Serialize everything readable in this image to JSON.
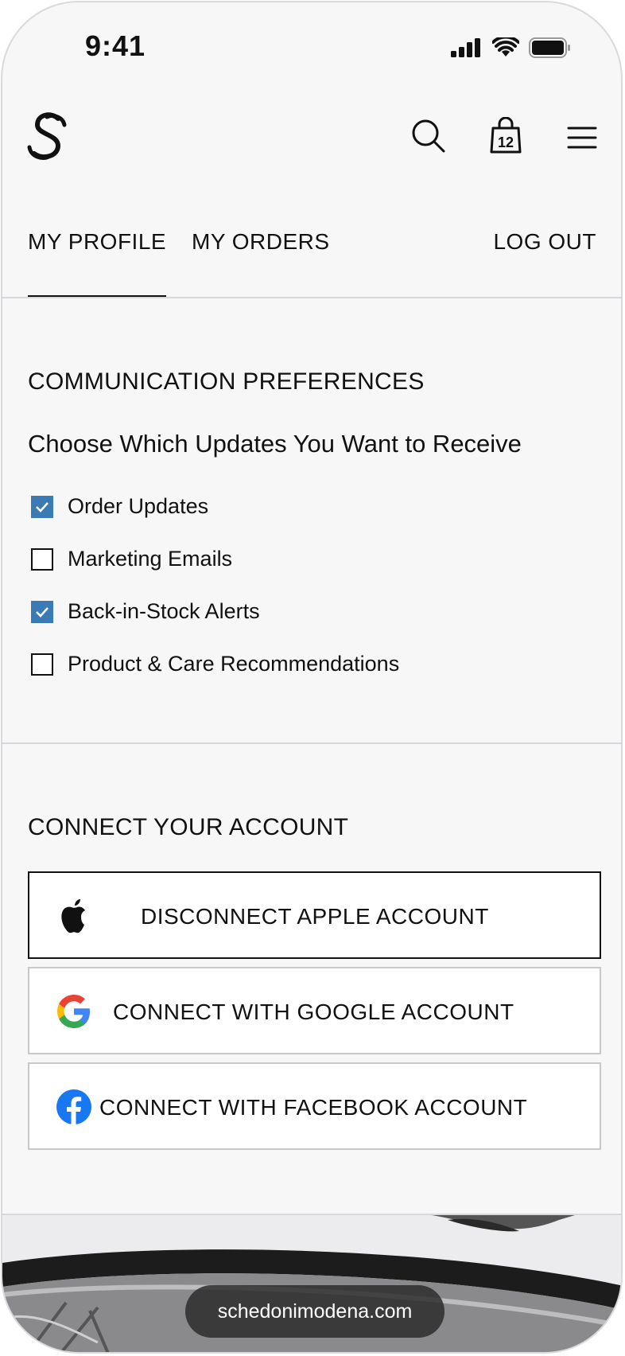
{
  "status": {
    "time": "9:41"
  },
  "header": {
    "logo_icon": "brand-s-logo",
    "search_icon": "search-icon",
    "bag_icon": "shopping-bag-icon",
    "bag_count": "12",
    "menu_icon": "hamburger-menu-icon"
  },
  "tabs": [
    {
      "label": "MY PROFILE",
      "active": true
    },
    {
      "label": "MY ORDERS",
      "active": false
    },
    {
      "label": "LOG OUT",
      "active": false
    }
  ],
  "communication": {
    "title": "COMMUNICATION PREFERENCES",
    "subtitle": "Choose Which Updates You Want to Receive",
    "options": [
      {
        "label": "Order Updates",
        "checked": true
      },
      {
        "label": "Marketing Emails",
        "checked": false
      },
      {
        "label": "Back-in-Stock Alerts",
        "checked": true
      },
      {
        "label": "Product & Care Recommendations",
        "checked": false
      }
    ],
    "checkbox_color": "#3a7ab5"
  },
  "connect": {
    "title": "CONNECT YOUR ACCOUNT",
    "buttons": [
      {
        "label": "DISCONNECT APPLE ACCOUNT",
        "icon": "apple-icon"
      },
      {
        "label": "CONNECT WITH GOOGLE ACCOUNT",
        "icon": "google-icon"
      },
      {
        "label": "CONNECT WITH FACEBOOK ACCOUNT",
        "icon": "facebook-icon"
      }
    ]
  },
  "browser": {
    "url": "schedonimodena.com"
  }
}
